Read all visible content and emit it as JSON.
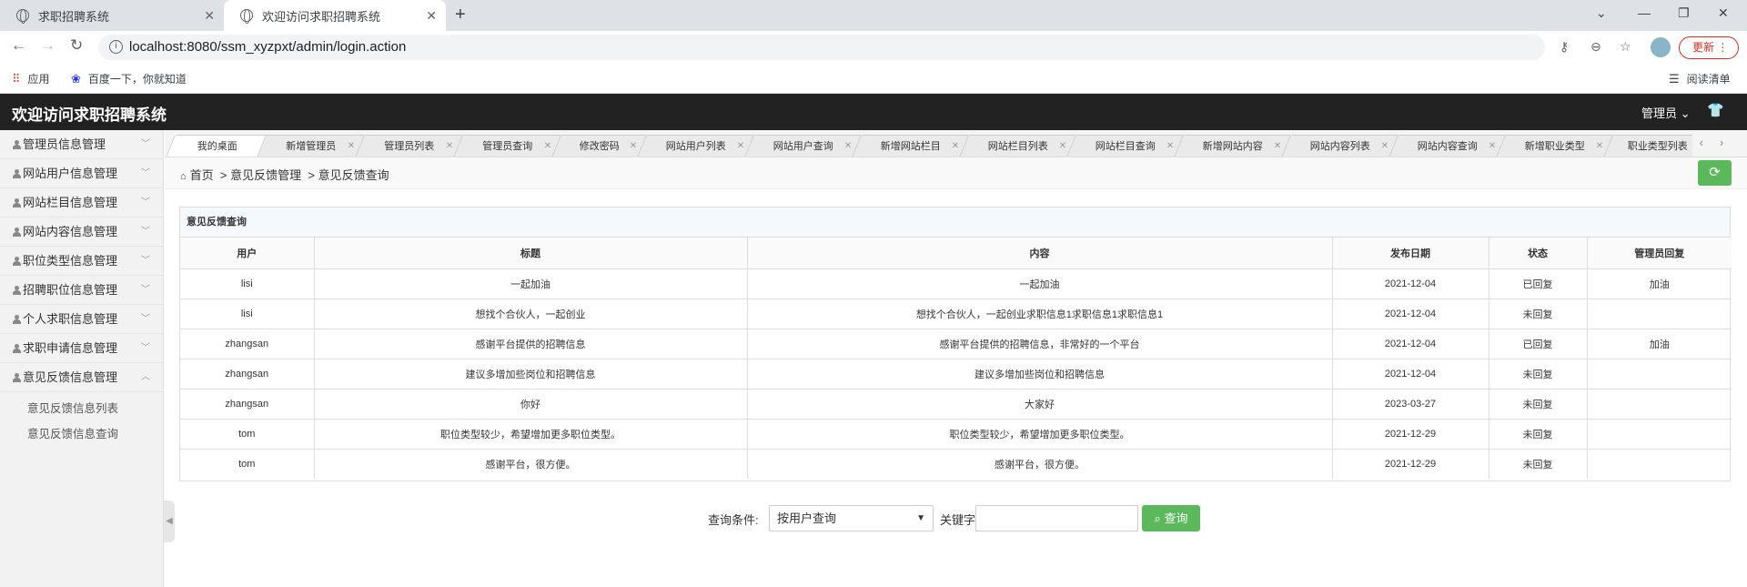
{
  "browser": {
    "tabs": [
      {
        "title": "求职招聘系统"
      },
      {
        "title": "欢迎访问求职招聘系统"
      }
    ],
    "url": "localhost:8080/ssm_xyzpxt/admin/login.action",
    "update_label": "更新",
    "bookmarks": {
      "apps": "应用",
      "baidu": "百度一下，你就知道",
      "reading_list": "阅读清单"
    }
  },
  "header": {
    "title": "欢迎访问求职招聘系统",
    "admin_label": "管理员"
  },
  "sidebar": {
    "items": [
      {
        "label": "管理员信息管理"
      },
      {
        "label": "网站用户信息管理"
      },
      {
        "label": "网站栏目信息管理"
      },
      {
        "label": "网站内容信息管理"
      },
      {
        "label": "职位类型信息管理"
      },
      {
        "label": "招聘职位信息管理"
      },
      {
        "label": "个人求职信息管理"
      },
      {
        "label": "求职申请信息管理"
      },
      {
        "label": "意见反馈信息管理"
      }
    ],
    "subitems": [
      {
        "label": "意见反馈信息列表"
      },
      {
        "label": "意见反馈信息查询"
      }
    ]
  },
  "page_tabs": [
    {
      "label": "我的桌面"
    },
    {
      "label": "新增管理员"
    },
    {
      "label": "管理员列表"
    },
    {
      "label": "管理员查询"
    },
    {
      "label": "修改密码"
    },
    {
      "label": "网站用户列表"
    },
    {
      "label": "网站用户查询"
    },
    {
      "label": "新增网站栏目"
    },
    {
      "label": "网站栏目列表"
    },
    {
      "label": "网站栏目查询"
    },
    {
      "label": "新增网站内容"
    },
    {
      "label": "网站内容列表"
    },
    {
      "label": "网站内容查询"
    },
    {
      "label": "新增职业类型"
    },
    {
      "label": "职业类型列表"
    }
  ],
  "breadcrumb": {
    "home": "首页",
    "section": "意见反馈管理",
    "current": "意见反馈查询"
  },
  "panel": {
    "title": "意见反馈查询",
    "columns": [
      "用户",
      "标题",
      "内容",
      "发布日期",
      "状态",
      "管理员回复"
    ],
    "rows": [
      [
        "lisi",
        "一起加油",
        "一起加油",
        "2021-12-04",
        "已回复",
        "加油"
      ],
      [
        "lisi",
        "想找个合伙人，一起创业",
        "想找个合伙人，一起创业求职信息1求职信息1求职信息1",
        "2021-12-04",
        "未回复",
        ""
      ],
      [
        "zhangsan",
        "感谢平台提供的招聘信息",
        "感谢平台提供的招聘信息，非常好的一个平台",
        "2021-12-04",
        "已回复",
        "加油"
      ],
      [
        "zhangsan",
        "建议多增加些岗位和招聘信息",
        "建议多增加些岗位和招聘信息",
        "2021-12-04",
        "未回复",
        ""
      ],
      [
        "zhangsan",
        "你好",
        "大家好",
        "2023-03-27",
        "未回复",
        ""
      ],
      [
        "tom",
        "职位类型较少，希望增加更多职位类型。",
        "职位类型较少，希望增加更多职位类型。",
        "2021-12-29",
        "未回复",
        ""
      ],
      [
        "tom",
        "感谢平台，很方便。",
        "感谢平台，很方便。",
        "2021-12-29",
        "未回复",
        ""
      ]
    ]
  },
  "query": {
    "condition_label": "查询条件:",
    "select_value": "按用户查询",
    "keyword_label": "关键字",
    "search_label": "查询"
  }
}
